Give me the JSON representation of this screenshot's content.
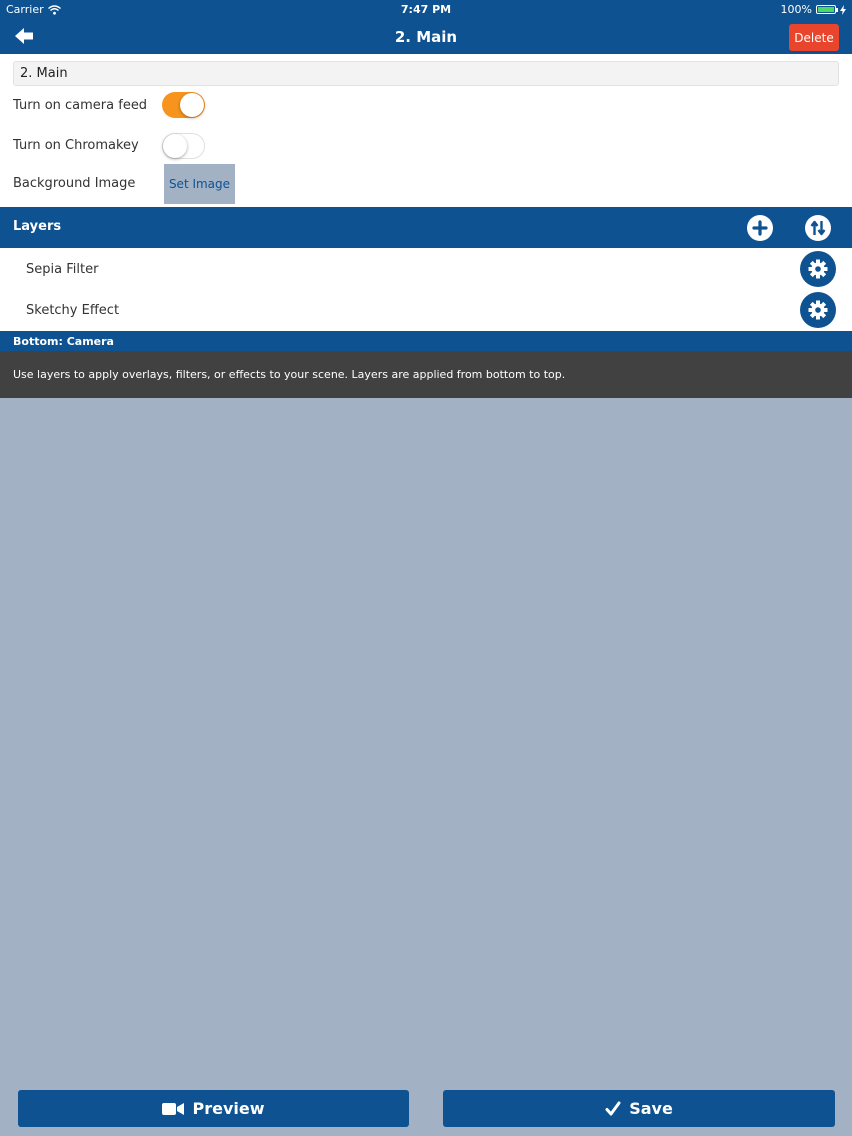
{
  "status_bar": {
    "carrier": "Carrier",
    "time": "7:47 PM",
    "battery": "100%",
    "battery_level": 1.0
  },
  "nav": {
    "title": "2. Main",
    "delete_label": "Delete",
    "back_icon": "arrow-left-icon"
  },
  "form": {
    "name_value": "2. Main",
    "camera_feed_label": "Turn on camera feed",
    "camera_feed_on": true,
    "chromakey_label": "Turn on Chromakey",
    "chromakey_on": false,
    "background_image_label": "Background Image",
    "set_image_label": "Set Image"
  },
  "layers": {
    "header": "Layers",
    "add_icon": "plus-circle-icon",
    "reorder_icon": "sort-arrows-icon",
    "items": [
      {
        "label": "Sepia Filter",
        "icon": "gear-icon"
      },
      {
        "label": "Sketchy Effect",
        "icon": "gear-icon"
      }
    ],
    "bottom_label": "Bottom: Camera",
    "info": "Use layers to apply overlays, filters, or effects to your scene. Layers are applied from bottom to top."
  },
  "footer": {
    "preview_label": "Preview",
    "preview_icon": "video-camera-icon",
    "save_label": "Save",
    "save_icon": "checkmark-icon"
  },
  "colors": {
    "primary": "#0e5291",
    "delete": "#e8452c",
    "toggle_on": "#f7941d",
    "background": "#a2b1c3",
    "info_bg": "#414141"
  }
}
